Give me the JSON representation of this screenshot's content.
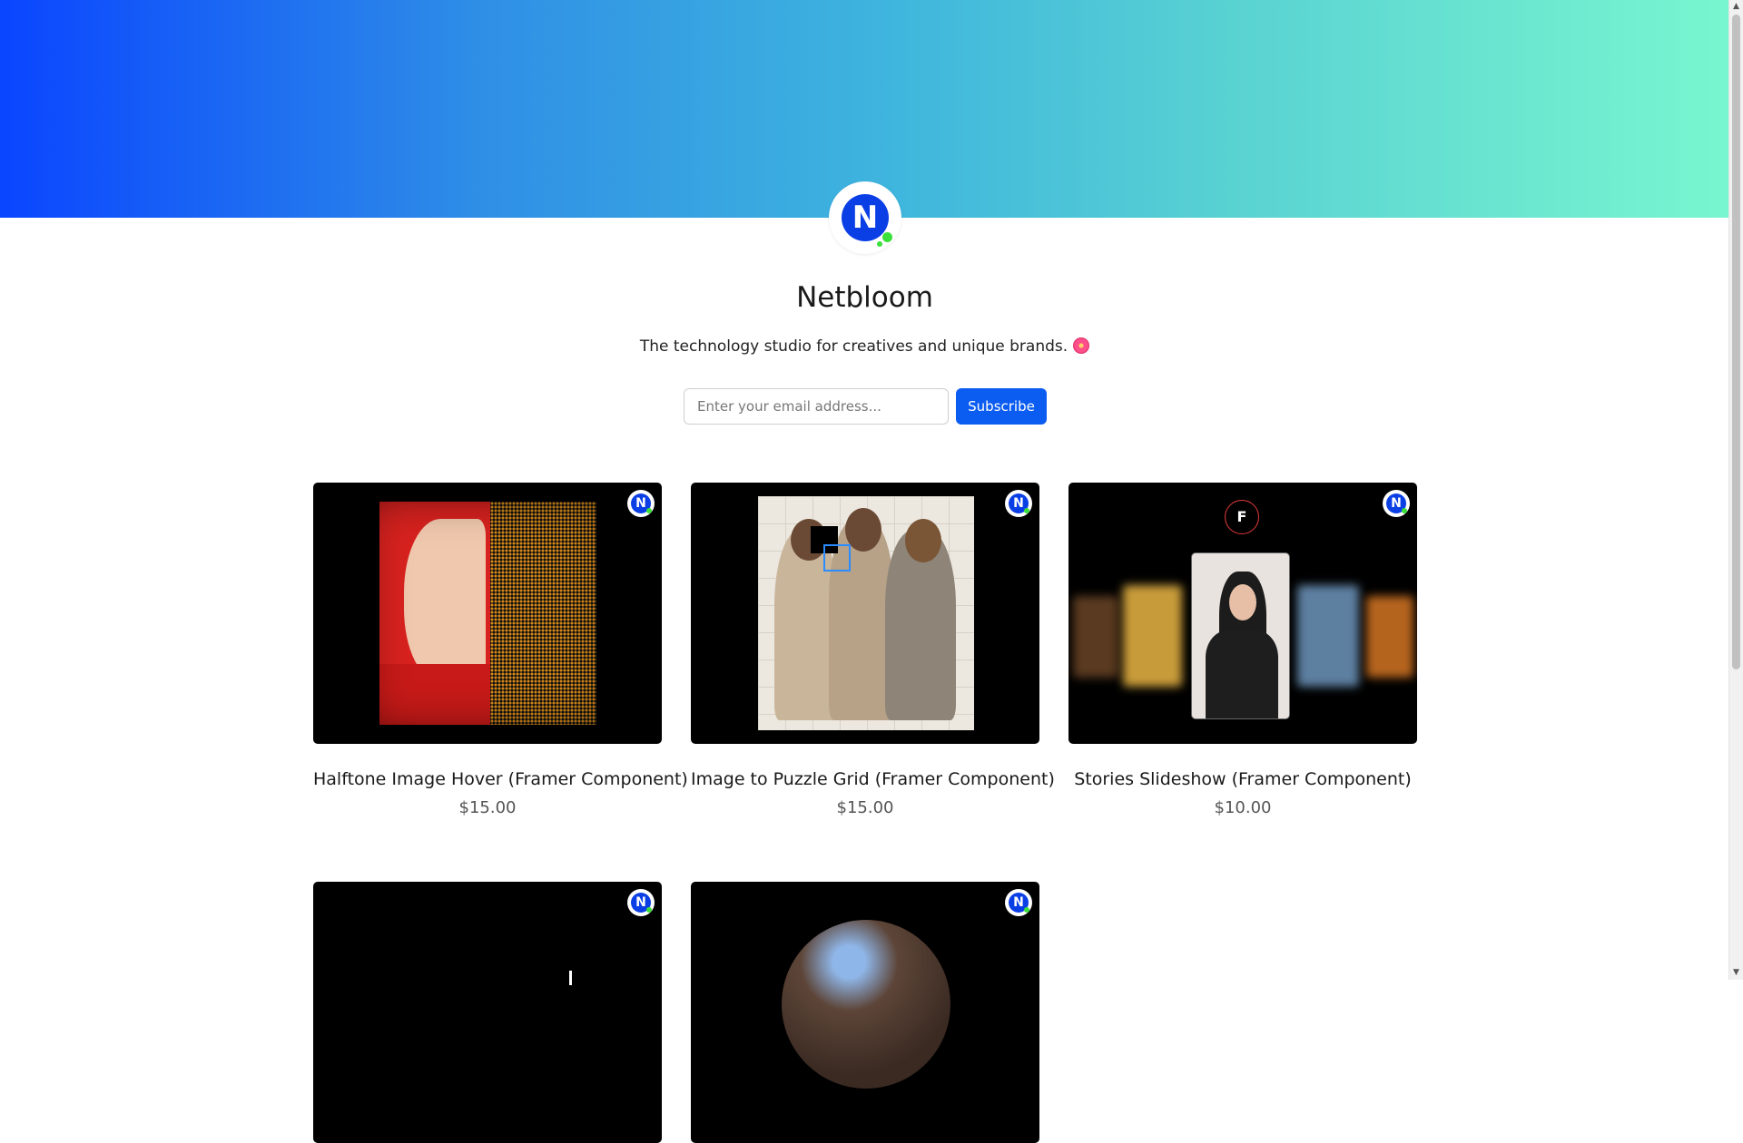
{
  "store": {
    "name": "Netbloom",
    "tagline": "The technology studio for creatives and unique brands.",
    "logo_letter": "N",
    "brand_color": "#0b3fe6",
    "accent_dot_color": "#3be03b"
  },
  "subscribe": {
    "placeholder": "Enter your email address...",
    "value": "",
    "button_label": "Subscribe",
    "button_color": "#0b5cf0"
  },
  "products": [
    {
      "title": "Halftone Image Hover (Framer Component)",
      "price": "$15.00"
    },
    {
      "title": "Image to Puzzle Grid (Framer Component)",
      "price": "$15.00"
    },
    {
      "title": "Stories Slideshow (Framer Component)",
      "price": "$10.00"
    },
    {
      "title": "",
      "price": ""
    },
    {
      "title": "",
      "price": ""
    }
  ],
  "icons": {
    "emoji": "hibiscus-icon",
    "framer": "framer-icon",
    "badge": "netbloom-logo-icon"
  }
}
